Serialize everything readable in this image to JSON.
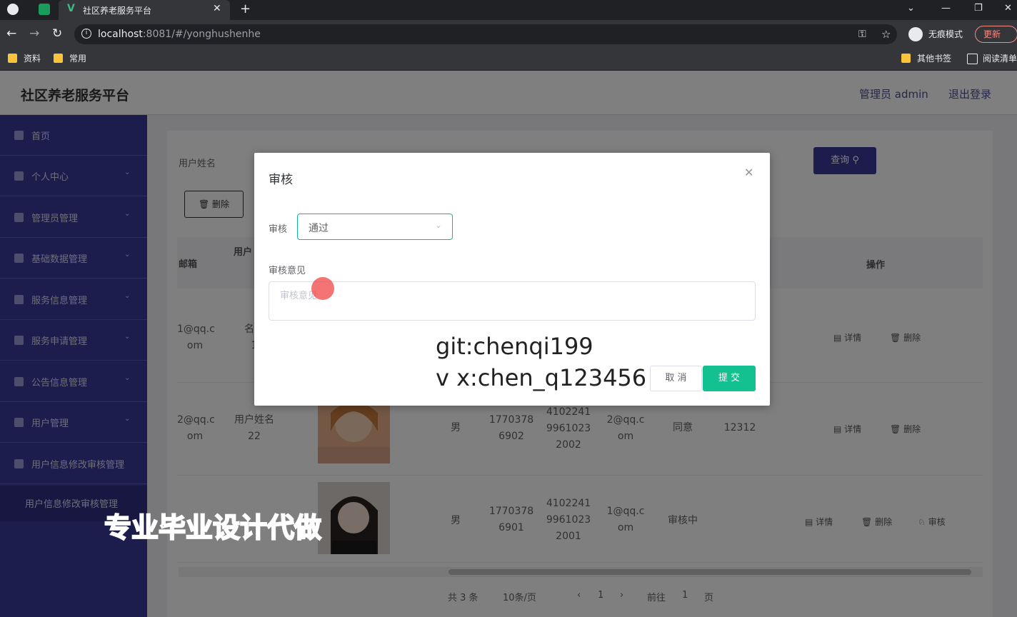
{
  "browser": {
    "tab_title": "社区养老服务平台",
    "url_host": "localhost",
    "url_rest": ":8081/#/yonghushenhe",
    "incognito_label": "无痕模式",
    "update_label": "更新",
    "bookmarks": [
      "资料",
      "常用"
    ],
    "bookmarks_right": [
      "其他书签",
      "阅读清单"
    ]
  },
  "app": {
    "brand": "社区养老服务平台",
    "admin_label": "管理员 admin",
    "logout_label": "退出登录"
  },
  "sidebar": {
    "items": [
      {
        "label": "首页",
        "chevron": ""
      },
      {
        "label": "个人中心",
        "chevron": "⌄"
      },
      {
        "label": "管理员管理",
        "chevron": "⌄"
      },
      {
        "label": "基础数据管理",
        "chevron": "⌄"
      },
      {
        "label": "服务信息管理",
        "chevron": "⌄"
      },
      {
        "label": "服务申请管理",
        "chevron": "⌄"
      },
      {
        "label": "公告信息管理",
        "chevron": "⌄"
      },
      {
        "label": "用户管理",
        "chevron": "⌄"
      },
      {
        "label": "用户信息修改审核管理",
        "chevron": ""
      }
    ],
    "submenu_label": "用户信息修改审核管理"
  },
  "toolbar": {
    "search_label": "用户姓名",
    "search_button": "查询",
    "delete_button": "删除"
  },
  "table": {
    "headers": {
      "email": "邮箱",
      "name": "用户",
      "ops": "操作"
    },
    "rows": [
      {
        "email": [
          "1@qq.c",
          "om"
        ],
        "name": [
          "名称",
          "1"
        ],
        "gender": "",
        "phone": [
          "",
          ""
        ],
        "id": [
          "",
          "",
          ""
        ],
        "email2": [
          "",
          ""
        ],
        "status": "",
        "note": "",
        "actions": [
          "详情",
          "删除"
        ]
      },
      {
        "email": [
          "2@qq.c",
          "om"
        ],
        "name": [
          "用户姓名",
          "22"
        ],
        "gender": "男",
        "phone": [
          "1770378",
          "6902"
        ],
        "id": [
          "4102241",
          "9961023",
          "2002"
        ],
        "email2": [
          "2@qq.c",
          "om"
        ],
        "status": "同意",
        "note": "12312",
        "actions": [
          "详情",
          "删除"
        ]
      },
      {
        "email": [
          "",
          ""
        ],
        "name": [
          "",
          ""
        ],
        "gender": "男",
        "phone": [
          "1770378",
          "6901"
        ],
        "id": [
          "4102241",
          "9961023",
          "2001"
        ],
        "email2": [
          "1@qq.c",
          "om"
        ],
        "status": "审核中",
        "note": "",
        "actions": [
          "详情",
          "删除",
          "审核"
        ]
      }
    ]
  },
  "pager": {
    "total": "共 3 条",
    "size": "10条/页",
    "current": "1",
    "goto": "前往",
    "goto_page": "1",
    "page_suffix": "页"
  },
  "modal": {
    "title": "审核",
    "review_label": "审核",
    "review_value": "通过",
    "comment_label": "审核意见",
    "comment_placeholder": "审核意见",
    "cancel": "取 消",
    "submit": "提 交"
  },
  "watermark": {
    "line1": "git:chenqi199",
    "line2": "v x:chen_q123456",
    "line3": "专业毕业设计代做"
  }
}
